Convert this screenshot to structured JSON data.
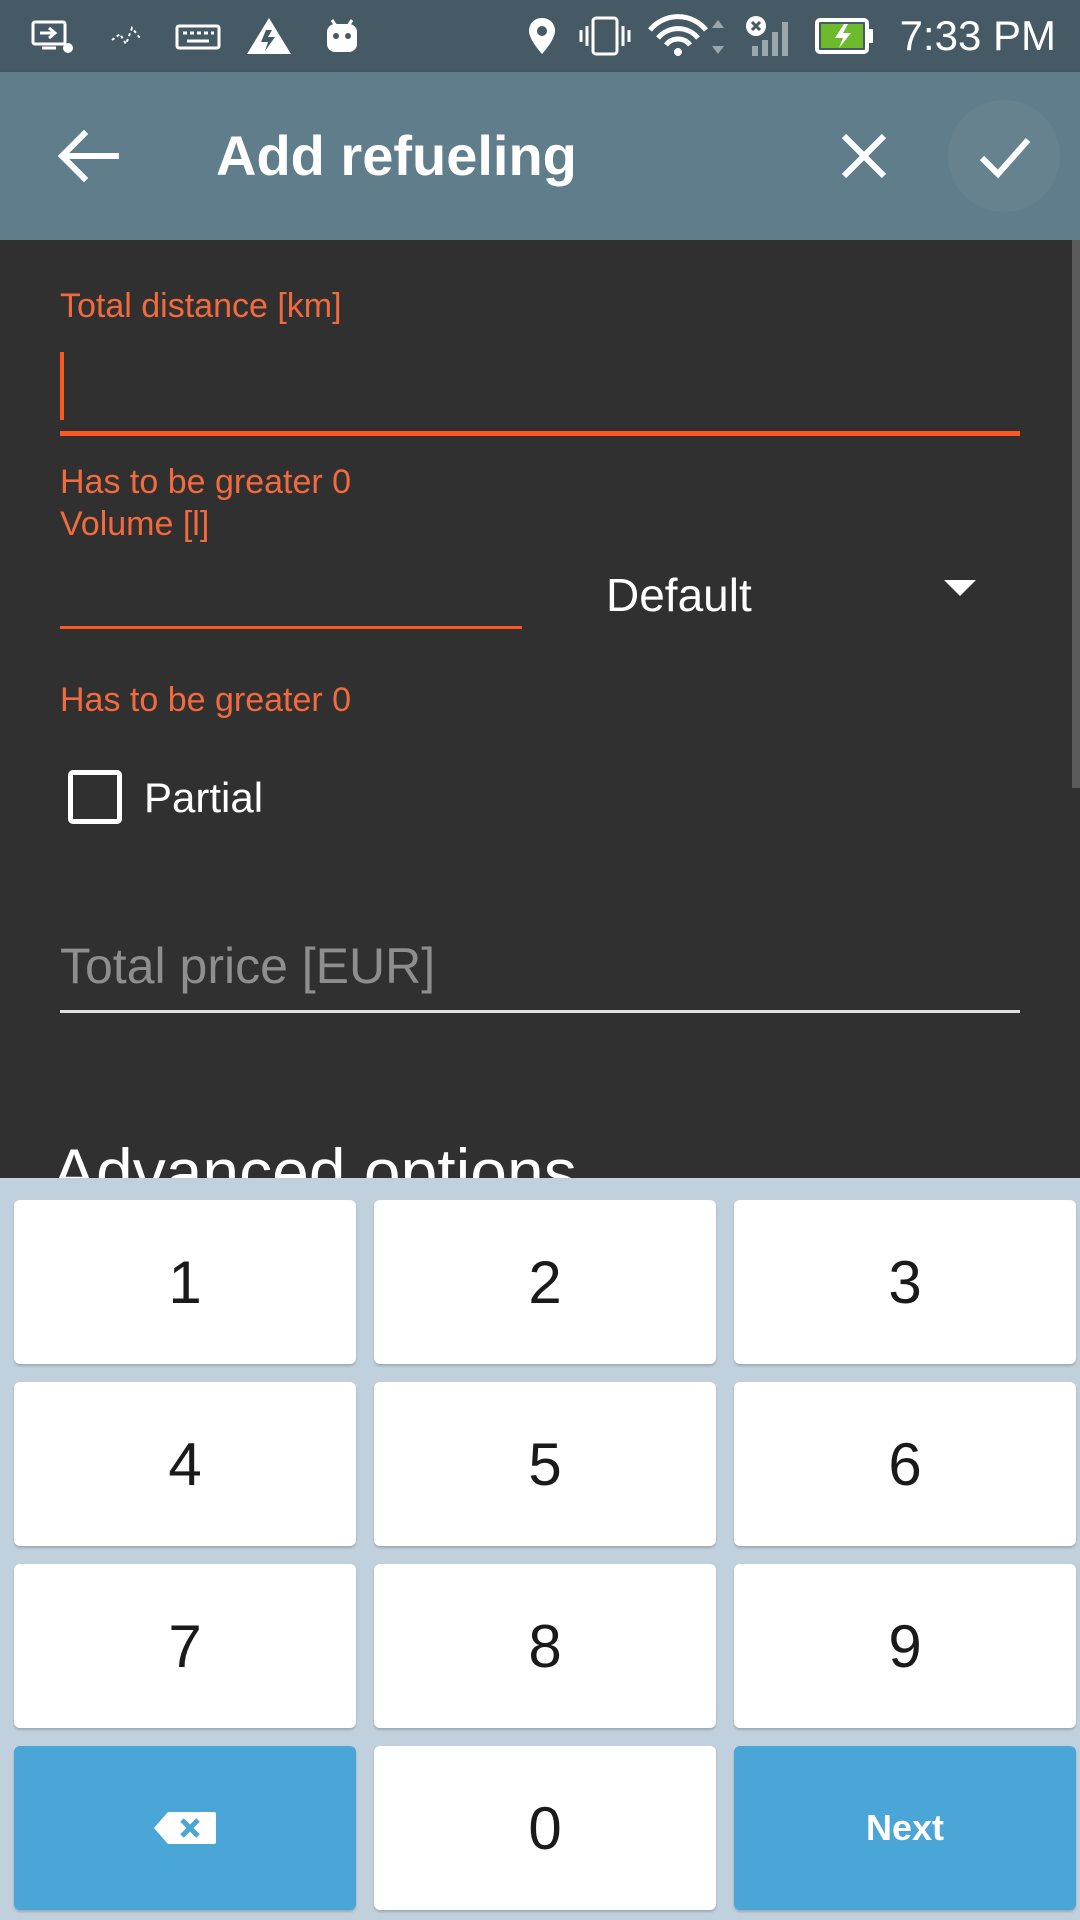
{
  "status_bar": {
    "time": "7:33 PM",
    "icons": [
      "screen-cast-icon",
      "activity-icon",
      "keyboard-icon",
      "warning-icon",
      "android-icon",
      "location-icon",
      "vibrate-icon",
      "wifi-icon",
      "no-signal-icon",
      "battery-charging-icon"
    ]
  },
  "app_bar": {
    "title": "Add refueling",
    "back_icon": "arrow-back-icon",
    "close_icon": "close-icon",
    "save_icon": "check-icon"
  },
  "form": {
    "total_distance": {
      "label": "Total distance [km]",
      "value": "",
      "error": "Has to be greater 0"
    },
    "volume": {
      "label": "Volume [l]",
      "value": "",
      "error": "Has to be greater 0"
    },
    "fuel_type": {
      "selected": "Default"
    },
    "partial": {
      "label": "Partial",
      "checked": false
    },
    "total_price": {
      "placeholder": "Total price [EUR]",
      "value": ""
    },
    "advanced_options_title": "Advanced options"
  },
  "keypad": {
    "keys": [
      "1",
      "2",
      "3",
      "4",
      "5",
      "6",
      "7",
      "8",
      "9",
      "0"
    ],
    "next_label": "Next",
    "backspace_icon": "backspace-icon"
  },
  "colors": {
    "status_bar": "#455a64",
    "app_bar": "#607d8b",
    "background": "#303030",
    "accent": "#ff5722",
    "error_text": "#f26a3d",
    "keypad_background": "#c0d0dc",
    "key_action": "#4aa6d6"
  }
}
